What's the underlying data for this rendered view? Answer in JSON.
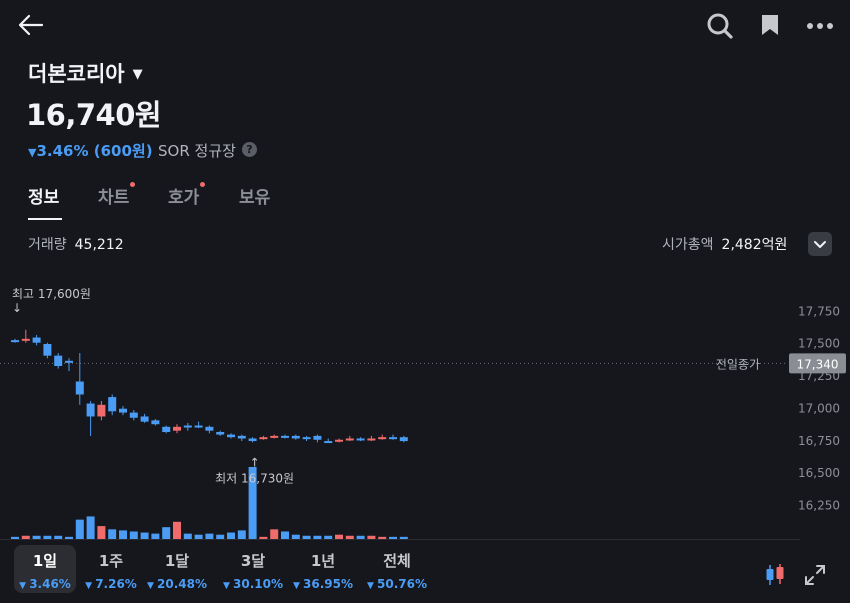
{
  "header": {
    "stock_name": "더본코리아",
    "price": "16,740원",
    "change": "3.46% (600원)",
    "market": "SOR 정규장",
    "help": "?"
  },
  "tabs": [
    {
      "label": "정보",
      "active": true,
      "badge": false
    },
    {
      "label": "차트",
      "active": false,
      "badge": true
    },
    {
      "label": "호가",
      "active": false,
      "badge": true
    },
    {
      "label": "보유",
      "active": false,
      "badge": false
    }
  ],
  "stats": {
    "volume_label": "거래량",
    "volume_value": "45,212",
    "mcap_label": "시가총액",
    "mcap_value": "2,482억원"
  },
  "chart_data": {
    "type": "candlestick",
    "y_ticks": [
      "17,750",
      "17,500",
      "17,250",
      "17,000",
      "16,750",
      "16,500",
      "16,250"
    ],
    "y_tick_values": [
      17750,
      17500,
      17250,
      17000,
      16750,
      16500,
      16250
    ],
    "ylim": [
      16130,
      17830
    ],
    "prev_close_label": "전일종가",
    "prev_close_value": "17,340",
    "prev_close": 17340,
    "high_label": "최고 17,600원",
    "high": 17600,
    "low_label": "최저 16,730원",
    "low": 16730,
    "up_color": "#f06b6b",
    "down_color": "#4a9cf5",
    "candles": [
      {
        "o": 17520,
        "c": 17520,
        "h": 17530,
        "l": 17500,
        "v": 2
      },
      {
        "o": 17520,
        "c": 17530,
        "h": 17600,
        "l": 17500,
        "v": 3
      },
      {
        "o": 17540,
        "c": 17500,
        "h": 17560,
        "l": 17480,
        "v": 3
      },
      {
        "o": 17490,
        "c": 17400,
        "h": 17500,
        "l": 17380,
        "v": 3
      },
      {
        "o": 17400,
        "c": 17320,
        "h": 17420,
        "l": 17300,
        "v": 3
      },
      {
        "o": 17360,
        "c": 17360,
        "h": 17380,
        "l": 17280,
        "v": 2
      },
      {
        "o": 17200,
        "c": 17100,
        "h": 17420,
        "l": 17020,
        "v": 18
      },
      {
        "o": 17030,
        "c": 16930,
        "h": 17050,
        "l": 16780,
        "v": 21
      },
      {
        "o": 16930,
        "c": 17020,
        "h": 17050,
        "l": 16900,
        "v": 12
      },
      {
        "o": 17080,
        "c": 16970,
        "h": 17100,
        "l": 16940,
        "v": 9
      },
      {
        "o": 16990,
        "c": 16960,
        "h": 17010,
        "l": 16940,
        "v": 8
      },
      {
        "o": 16960,
        "c": 16920,
        "h": 16980,
        "l": 16900,
        "v": 7
      },
      {
        "o": 16930,
        "c": 16890,
        "h": 16950,
        "l": 16880,
        "v": 6
      },
      {
        "o": 16900,
        "c": 16870,
        "h": 16910,
        "l": 16860,
        "v": 5
      },
      {
        "o": 16850,
        "c": 16810,
        "h": 16860,
        "l": 16800,
        "v": 11
      },
      {
        "o": 16820,
        "c": 16850,
        "h": 16870,
        "l": 16800,
        "v": 16
      },
      {
        "o": 16860,
        "c": 16850,
        "h": 16880,
        "l": 16820,
        "v": 5
      },
      {
        "o": 16860,
        "c": 16850,
        "h": 16890,
        "l": 16840,
        "v": 4
      },
      {
        "o": 16850,
        "c": 16820,
        "h": 16860,
        "l": 16800,
        "v": 5
      },
      {
        "o": 16810,
        "c": 16790,
        "h": 16820,
        "l": 16780,
        "v": 4
      },
      {
        "o": 16790,
        "c": 16770,
        "h": 16800,
        "l": 16760,
        "v": 6
      },
      {
        "o": 16780,
        "c": 16760,
        "h": 16790,
        "l": 16740,
        "v": 8
      },
      {
        "o": 16760,
        "c": 16740,
        "h": 16770,
        "l": 16730,
        "v": 67
      },
      {
        "o": 16760,
        "c": 16770,
        "h": 16780,
        "l": 16750,
        "v": 2
      },
      {
        "o": 16770,
        "c": 16780,
        "h": 16790,
        "l": 16760,
        "v": 9
      },
      {
        "o": 16780,
        "c": 16770,
        "h": 16790,
        "l": 16760,
        "v": 7
      },
      {
        "o": 16780,
        "c": 16760,
        "h": 16790,
        "l": 16750,
        "v": 4
      },
      {
        "o": 16770,
        "c": 16760,
        "h": 16780,
        "l": 16740,
        "v": 3
      },
      {
        "o": 16780,
        "c": 16750,
        "h": 16790,
        "l": 16730,
        "v": 3
      },
      {
        "o": 16740,
        "c": 16740,
        "h": 16760,
        "l": 16730,
        "v": 3
      },
      {
        "o": 16740,
        "c": 16750,
        "h": 16760,
        "l": 16730,
        "v": 4
      },
      {
        "o": 16750,
        "c": 16760,
        "h": 16780,
        "l": 16740,
        "v": 3
      },
      {
        "o": 16760,
        "c": 16750,
        "h": 16770,
        "l": 16740,
        "v": 3
      },
      {
        "o": 16750,
        "c": 16760,
        "h": 16780,
        "l": 16740,
        "v": 3
      },
      {
        "o": 16760,
        "c": 16770,
        "h": 16790,
        "l": 16750,
        "v": 2
      },
      {
        "o": 16770,
        "c": 16760,
        "h": 16790,
        "l": 16750,
        "v": 2
      },
      {
        "o": 16770,
        "c": 16740,
        "h": 16780,
        "l": 16730,
        "v": 2
      }
    ]
  },
  "ranges": [
    {
      "label": "1일",
      "pct": "3.46%",
      "active": true
    },
    {
      "label": "1주",
      "pct": "7.26%",
      "active": false
    },
    {
      "label": "1달",
      "pct": "20.48%",
      "active": false
    },
    {
      "label": "3달",
      "pct": "30.10%",
      "active": false
    },
    {
      "label": "1년",
      "pct": "36.95%",
      "active": false
    },
    {
      "label": "전체",
      "pct": "50.76%",
      "active": false
    }
  ],
  "icons": {
    "back": "arrow-left-icon",
    "search": "search-icon",
    "bookmark": "bookmark-icon",
    "more": "more-icon",
    "candle": "candlestick-icon",
    "fullscreen": "fullscreen-icon"
  }
}
